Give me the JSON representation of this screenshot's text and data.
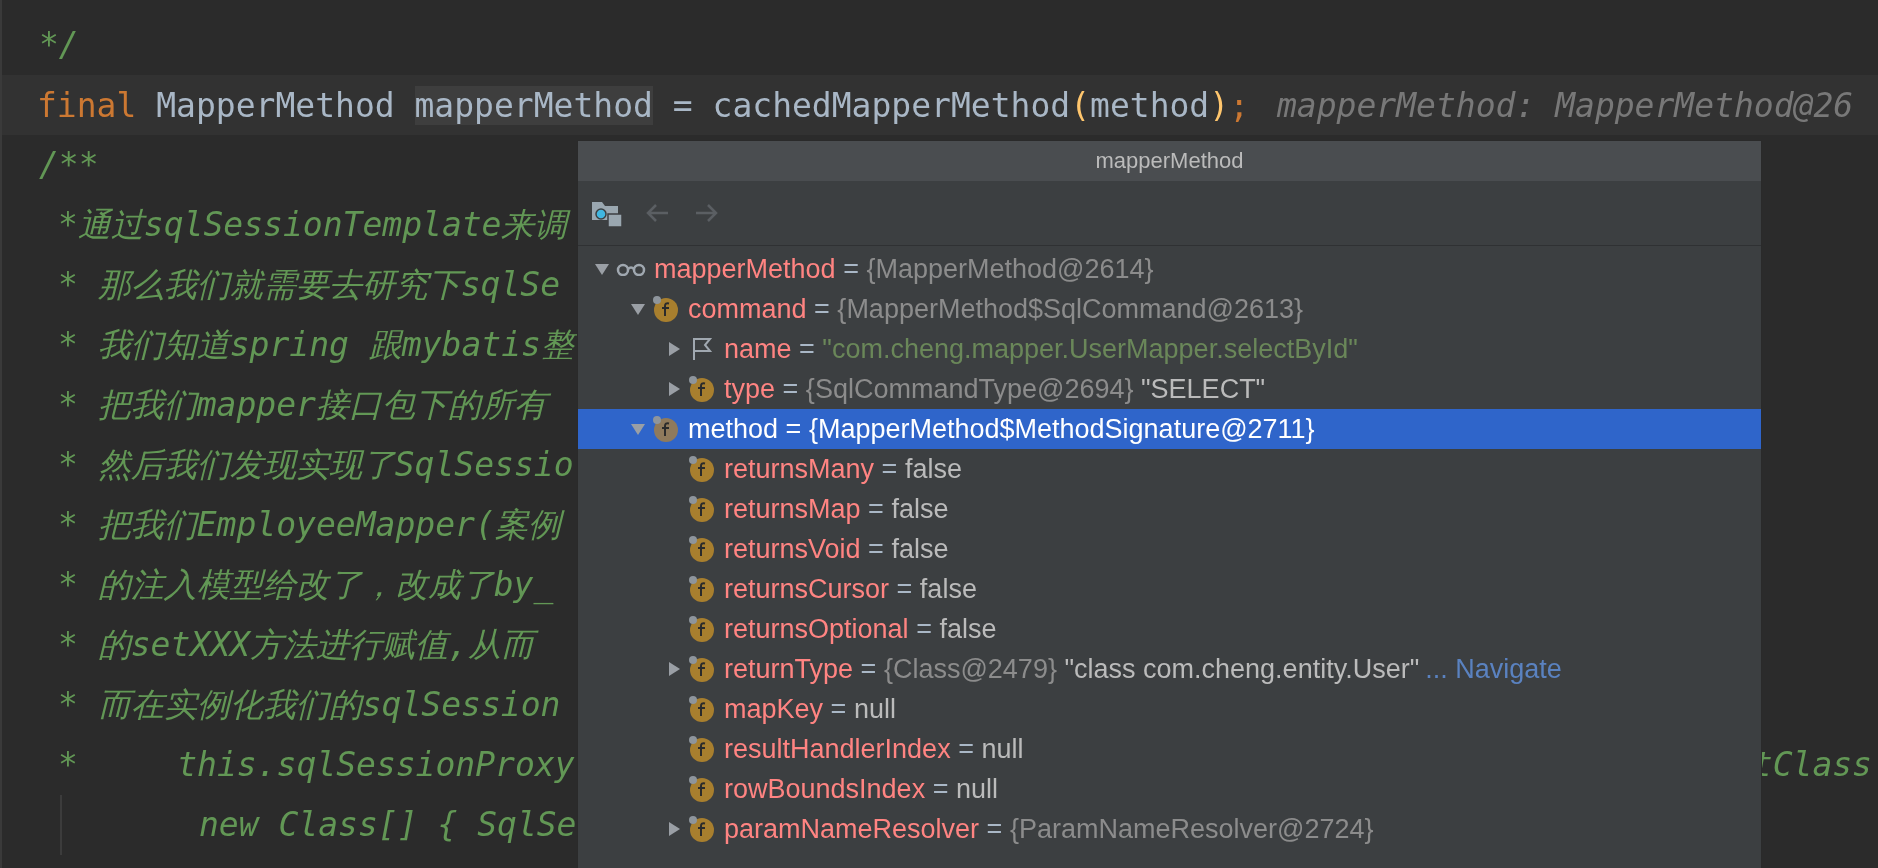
{
  "editor": {
    "lines": [
      {
        "kind": "doc_edge",
        "text": "*/"
      },
      {
        "kind": "code",
        "tokens": [
          {
            "kind": "keyword",
            "text": "final"
          },
          {
            "kind": "plain",
            "text": " MapperMethod "
          },
          {
            "kind": "usage",
            "text": "mapperMethod"
          },
          {
            "kind": "plain",
            "text": " = cachedMapperMethod"
          },
          {
            "kind": "brace",
            "text": "("
          },
          {
            "kind": "plain",
            "text": "method"
          },
          {
            "kind": "brace",
            "text": ")"
          },
          {
            "kind": "keyword",
            "text": ";"
          }
        ],
        "hint": "mapperMethod: MapperMethod@26"
      },
      {
        "kind": "doc_edge",
        "text": "/**"
      },
      {
        "kind": "doc_body",
        "text": "*通过sqlSessionTemplate来调"
      },
      {
        "kind": "doc_body",
        "text": "* 那么我们就需要去研究下sqlSe"
      },
      {
        "kind": "doc_body",
        "text": "* 我们知道spring 跟mybatis整"
      },
      {
        "kind": "doc_body",
        "text": "* 把我们mapper接口包下的所有"
      },
      {
        "kind": "doc_body",
        "text": "* 然后我们发现实现了SqlSessio"
      },
      {
        "kind": "doc_body",
        "text": "* 把我们EmployeeMapper(案例"
      },
      {
        "kind": "doc_body",
        "text": "* 的注入模型给改了，改成了by_"
      },
      {
        "kind": "doc_body",
        "text": "* 的setXXX方法进行赋值,从而"
      },
      {
        "kind": "doc_body",
        "text": "* 而在实例化我们的sqlSession"
      },
      {
        "kind": "doc_body",
        "text": "*     this.sqlSessionProxy",
        "right_text": "tClass"
      },
      {
        "kind": "continuation",
        "text": "new Class[] { SqlSe"
      }
    ]
  },
  "popup": {
    "title": "mapperMethod",
    "toolbar": {
      "back": {
        "disabled": true
      },
      "forward": {
        "disabled": true
      }
    },
    "tree": [
      {
        "kind": "watch",
        "name": "mapperMethod",
        "eq": "=",
        "ref": "{MapperMethod@2614}",
        "expanded": true,
        "selected": false,
        "children": [
          {
            "kind": "field",
            "name": "command",
            "eq": "=",
            "ref": "{MapperMethod$SqlCommand@2613}",
            "expanded": true,
            "selected": false,
            "children": [
              {
                "kind": "flag",
                "name": "name",
                "eq": "=",
                "string": "\"com.cheng.mapper.UserMapper.selectById\"",
                "expanded": false,
                "selected": false
              },
              {
                "kind": "field",
                "name": "type",
                "eq": "=",
                "ref": "{SqlCommandType@2694}",
                "text": "\"SELECT\"",
                "expanded": false,
                "selected": false
              }
            ]
          },
          {
            "kind": "field",
            "name": "method",
            "eq": "=",
            "ref": "{MapperMethod$MethodSignature@2711}",
            "expanded": true,
            "selected": true,
            "children": [
              {
                "kind": "field",
                "name": "returnsMany",
                "eq": "=",
                "text": "false",
                "selected": false
              },
              {
                "kind": "field",
                "name": "returnsMap",
                "eq": "=",
                "text": "false",
                "selected": false
              },
              {
                "kind": "field",
                "name": "returnsVoid",
                "eq": "=",
                "text": "false",
                "selected": false
              },
              {
                "kind": "field",
                "name": "returnsCursor",
                "eq": "=",
                "text": "false",
                "selected": false
              },
              {
                "kind": "field",
                "name": "returnsOptional",
                "eq": "=",
                "text": "false",
                "selected": false
              },
              {
                "kind": "field",
                "name": "returnType",
                "eq": "=",
                "ref": "{Class@2479}",
                "text": "\"class com.cheng.entity.User\"",
                "link": "... Navigate",
                "expanded": false,
                "selected": false
              },
              {
                "kind": "field",
                "name": "mapKey",
                "eq": "=",
                "text": "null",
                "selected": false
              },
              {
                "kind": "field",
                "name": "resultHandlerIndex",
                "eq": "=",
                "text": "null",
                "selected": false
              },
              {
                "kind": "field",
                "name": "rowBoundsIndex",
                "eq": "=",
                "text": "null",
                "selected": false
              },
              {
                "kind": "field",
                "name": "paramNameResolver",
                "eq": "=",
                "ref": "{ParamNameResolver@2724}",
                "expanded": false,
                "selected": false
              }
            ]
          }
        ]
      }
    ]
  }
}
